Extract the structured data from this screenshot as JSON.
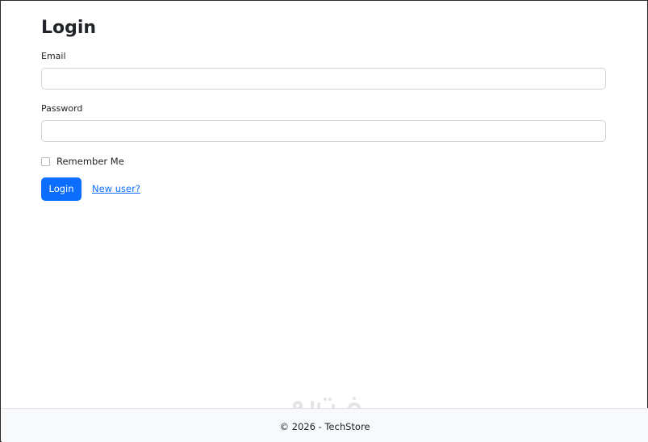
{
  "login": {
    "title": "Login",
    "email_label": "Email",
    "email_value": "",
    "password_label": "Password",
    "password_value": "",
    "remember_label": "Remember Me",
    "remember_checked": false,
    "submit_label": "Login",
    "register_link": "New user?"
  },
  "footer": {
    "text": "© 2026 - TechStore"
  },
  "colors": {
    "primary": "#0d6efd",
    "footer_bg": "#f8f9fa",
    "text": "#212529"
  },
  "icons": {
    "watermark": "mostaql-logo-watermark"
  }
}
